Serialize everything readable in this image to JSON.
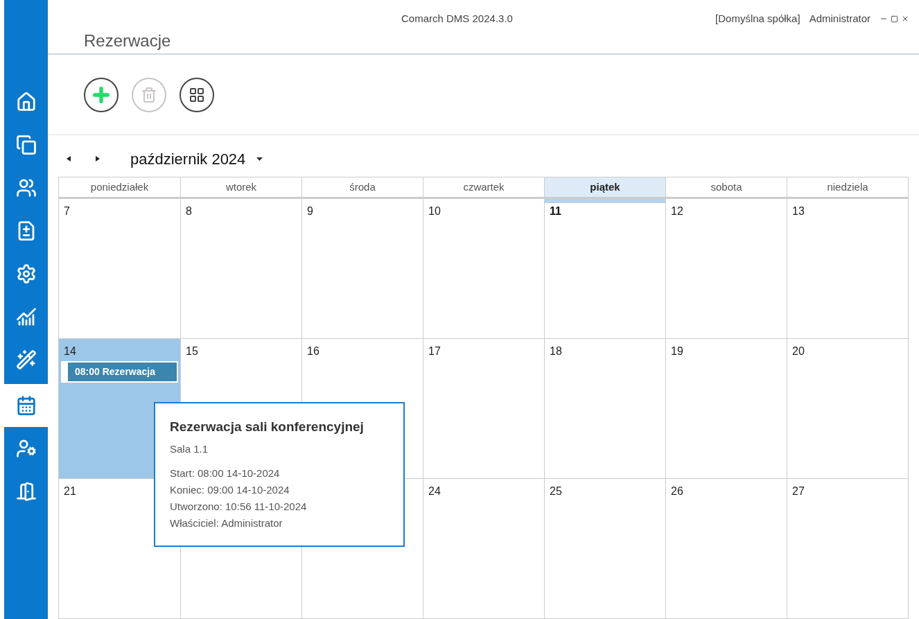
{
  "window": {
    "title": "Comarch DMS 2024.3.0",
    "company": "[Domyślna spółka]",
    "user": "Administrator"
  },
  "page_title": "Rezerwacje",
  "sidebar": {
    "items": [
      {
        "kind": "home",
        "selected": false
      },
      {
        "kind": "documents",
        "selected": false
      },
      {
        "kind": "users",
        "selected": false
      },
      {
        "kind": "sync",
        "selected": false
      },
      {
        "kind": "settings",
        "selected": false
      },
      {
        "kind": "reports",
        "selected": false
      },
      {
        "kind": "wizard",
        "selected": false
      },
      {
        "kind": "calendar",
        "selected": true
      },
      {
        "kind": "admin",
        "selected": false
      },
      {
        "kind": "exit",
        "selected": false
      }
    ]
  },
  "toolbar": [
    {
      "kind": "add",
      "disabled": false
    },
    {
      "kind": "delete",
      "disabled": true
    },
    {
      "kind": "views",
      "disabled": false
    }
  ],
  "calendar": {
    "month": "październik 2024",
    "weekdays": [
      {
        "label": "poniedziałek",
        "selected": false
      },
      {
        "label": "wtorek",
        "selected": false
      },
      {
        "label": "środa",
        "selected": false
      },
      {
        "label": "czwartek",
        "selected": false
      },
      {
        "label": "piątek",
        "selected": true
      },
      {
        "label": "sobota",
        "selected": false
      },
      {
        "label": "niedziela",
        "selected": false
      }
    ],
    "weeks": [
      [
        {
          "number": "7",
          "today": false,
          "selected": false
        },
        {
          "number": "8",
          "today": false,
          "selected": false
        },
        {
          "number": "9",
          "today": false,
          "selected": false
        },
        {
          "number": "10",
          "today": false,
          "selected": false
        },
        {
          "number": "11",
          "today": true,
          "selected": false
        },
        {
          "number": "12",
          "today": false,
          "selected": false
        },
        {
          "number": "13",
          "today": false,
          "selected": false
        }
      ],
      [
        {
          "number": "14",
          "today": false,
          "selected": true,
          "events": [
            {
              "label": "08:00 Rezerwacja"
            }
          ]
        },
        {
          "number": "15",
          "today": false,
          "selected": false
        },
        {
          "number": "16",
          "today": false,
          "selected": false
        },
        {
          "number": "17",
          "today": false,
          "selected": false
        },
        {
          "number": "18",
          "today": false,
          "selected": false
        },
        {
          "number": "19",
          "today": false,
          "selected": false
        },
        {
          "number": "20",
          "today": false,
          "selected": false
        }
      ],
      [
        {
          "number": "21",
          "today": false,
          "selected": false
        },
        {
          "selected": false
        },
        {
          "selected": false
        },
        {
          "number": "24",
          "today": false,
          "selected": false
        },
        {
          "number": "25",
          "today": false,
          "selected": false
        },
        {
          "number": "26",
          "today": false,
          "selected": false
        },
        {
          "number": "27",
          "today": false,
          "selected": false
        }
      ]
    ]
  },
  "tooltip": {
    "title": "Rezerwacja sali konferencyjnej",
    "subtitle": "Sala 1.1",
    "lines": [
      "Start: 08:00 14-10-2024",
      "Koniec: 09:00 14-10-2024",
      "Utworzono: 10:56 11-10-2024",
      "Właściciel: Administrator"
    ]
  }
}
